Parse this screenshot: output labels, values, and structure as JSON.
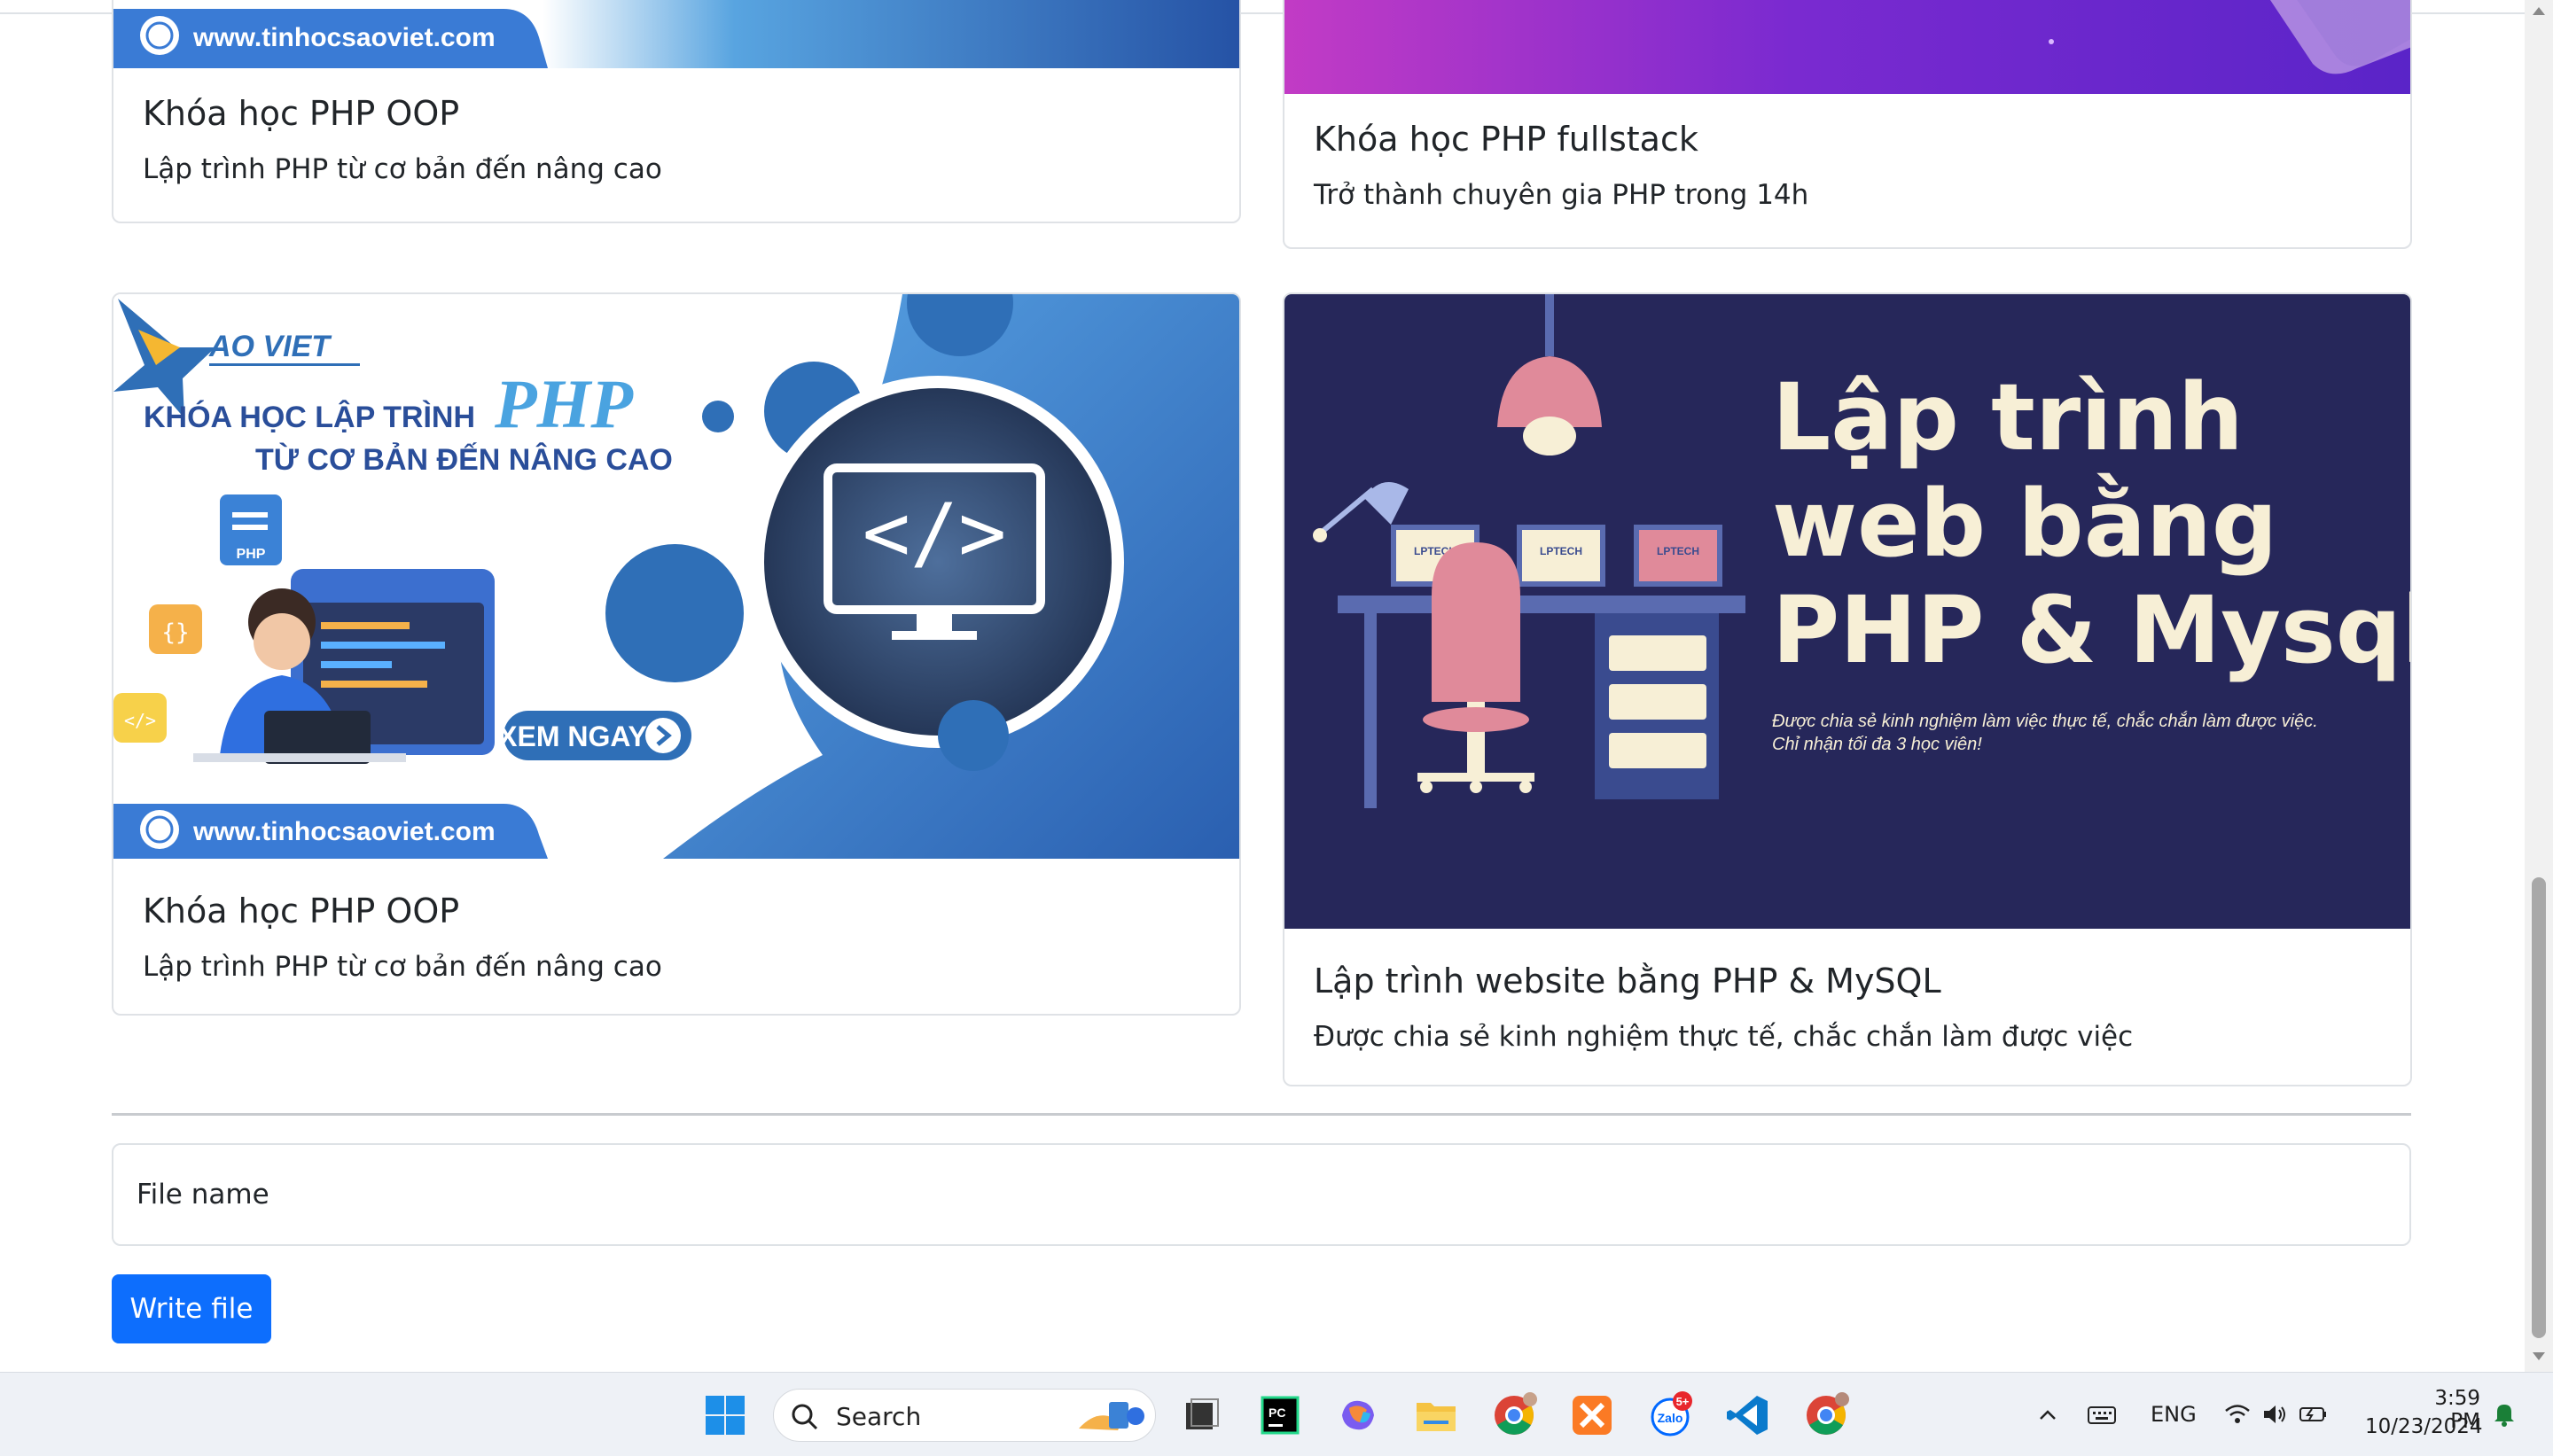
{
  "cards": [
    {
      "title": "Khóa học PHP OOP",
      "text": "Lập trình PHP từ cơ bản đến nâng cao",
      "banner_url": "www.tinhocsaoviet.com"
    },
    {
      "title": "Khóa học PHP fullstack",
      "text": "Trở thành chuyên gia PHP trong 14h"
    },
    {
      "title": "Khóa học PHP OOP",
      "text": "Lập trình PHP từ cơ bản đến nâng cao",
      "banner": {
        "brand": "AO VIET",
        "headline_1": "KHÓA HỌC LẬP TRÌNH",
        "headline_php": "PHP",
        "headline_2": "TỪ CƠ BẢN ĐẾN NÂNG CAO",
        "file_label": "PHP",
        "cta": "XEM NGAY",
        "url": "www.tinhocsaoviet.com"
      }
    },
    {
      "title": "Lập trình website bằng PHP & MySQL",
      "text": "Được chia sẻ kinh nghiệm thực tế, chắc chắn làm được việc",
      "banner": {
        "line_1": "Lập trình",
        "line_2": "web bằng",
        "line_3": "PHP & Mysql",
        "sub_1": "Được chia sẻ kinh nghiệm làm việc thực tế, chắc chắn làm được việc.",
        "sub_2": "Chỉ nhận tối đa 3 học viên!",
        "laptop_label": "LPTECH"
      }
    }
  ],
  "form": {
    "file_placeholder": "File name",
    "write_button": "Write file"
  },
  "taskbar": {
    "search_placeholder": "Search",
    "language": "ENG",
    "time": "3:59 PM",
    "date": "10/23/2024",
    "zalo_badge": "5+",
    "zalo_label": "Zalo",
    "pinned": [
      "windows-start-icon",
      "search-icon",
      "task-view-icon",
      "pycharm-icon",
      "copilot-icon",
      "file-explorer-icon",
      "chrome-icon",
      "xampp-icon",
      "zalo-icon",
      "vscode-icon",
      "chrome-profile-icon"
    ]
  },
  "colors": {
    "primary": "#0d6efd",
    "banner_navy": "#26275a",
    "banner_blue": "#2f6fb7",
    "banner_cream": "#f7efd6"
  }
}
